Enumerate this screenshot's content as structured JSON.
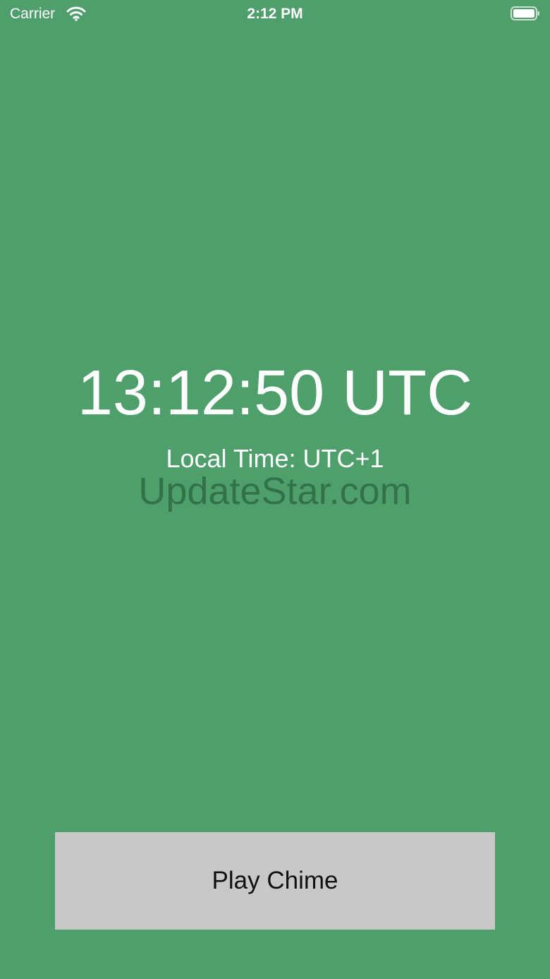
{
  "status_bar": {
    "carrier": "Carrier",
    "time": "2:12 PM",
    "icons": [
      "wifi-icon",
      "battery-icon"
    ]
  },
  "main": {
    "utc_time": "13:12:50 UTC",
    "local_time": "Local Time: UTC+1",
    "watermark": "UpdateStar.com"
  },
  "actions": {
    "play_chime_label": "Play Chime"
  },
  "colors": {
    "background": "#4f9f6d",
    "text": "#ffffff",
    "button_background": "#c8c8ca",
    "button_text": "#111111"
  }
}
